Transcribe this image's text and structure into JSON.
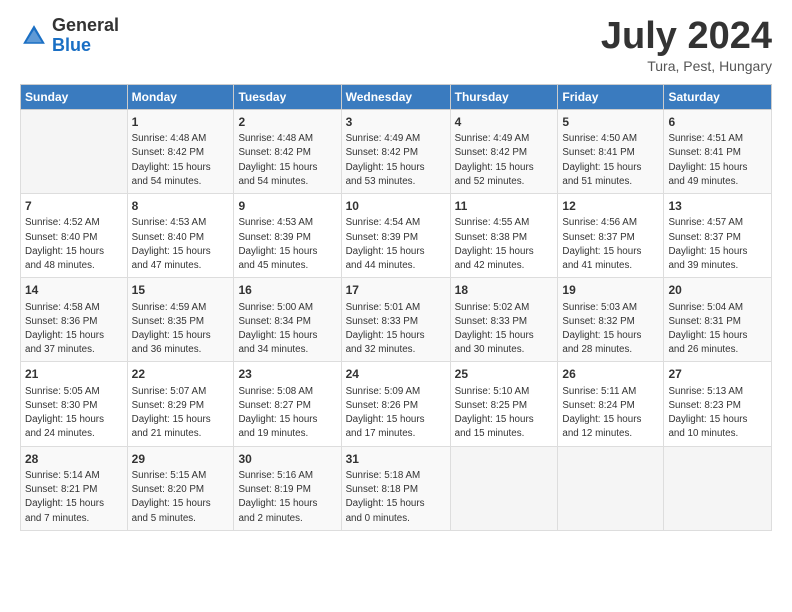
{
  "logo": {
    "general": "General",
    "blue": "Blue"
  },
  "title": "July 2024",
  "location": "Tura, Pest, Hungary",
  "header_days": [
    "Sunday",
    "Monday",
    "Tuesday",
    "Wednesday",
    "Thursday",
    "Friday",
    "Saturday"
  ],
  "weeks": [
    [
      {
        "num": "",
        "info": ""
      },
      {
        "num": "1",
        "info": "Sunrise: 4:48 AM\nSunset: 8:42 PM\nDaylight: 15 hours\nand 54 minutes."
      },
      {
        "num": "2",
        "info": "Sunrise: 4:48 AM\nSunset: 8:42 PM\nDaylight: 15 hours\nand 54 minutes."
      },
      {
        "num": "3",
        "info": "Sunrise: 4:49 AM\nSunset: 8:42 PM\nDaylight: 15 hours\nand 53 minutes."
      },
      {
        "num": "4",
        "info": "Sunrise: 4:49 AM\nSunset: 8:42 PM\nDaylight: 15 hours\nand 52 minutes."
      },
      {
        "num": "5",
        "info": "Sunrise: 4:50 AM\nSunset: 8:41 PM\nDaylight: 15 hours\nand 51 minutes."
      },
      {
        "num": "6",
        "info": "Sunrise: 4:51 AM\nSunset: 8:41 PM\nDaylight: 15 hours\nand 49 minutes."
      }
    ],
    [
      {
        "num": "7",
        "info": "Sunrise: 4:52 AM\nSunset: 8:40 PM\nDaylight: 15 hours\nand 48 minutes."
      },
      {
        "num": "8",
        "info": "Sunrise: 4:53 AM\nSunset: 8:40 PM\nDaylight: 15 hours\nand 47 minutes."
      },
      {
        "num": "9",
        "info": "Sunrise: 4:53 AM\nSunset: 8:39 PM\nDaylight: 15 hours\nand 45 minutes."
      },
      {
        "num": "10",
        "info": "Sunrise: 4:54 AM\nSunset: 8:39 PM\nDaylight: 15 hours\nand 44 minutes."
      },
      {
        "num": "11",
        "info": "Sunrise: 4:55 AM\nSunset: 8:38 PM\nDaylight: 15 hours\nand 42 minutes."
      },
      {
        "num": "12",
        "info": "Sunrise: 4:56 AM\nSunset: 8:37 PM\nDaylight: 15 hours\nand 41 minutes."
      },
      {
        "num": "13",
        "info": "Sunrise: 4:57 AM\nSunset: 8:37 PM\nDaylight: 15 hours\nand 39 minutes."
      }
    ],
    [
      {
        "num": "14",
        "info": "Sunrise: 4:58 AM\nSunset: 8:36 PM\nDaylight: 15 hours\nand 37 minutes."
      },
      {
        "num": "15",
        "info": "Sunrise: 4:59 AM\nSunset: 8:35 PM\nDaylight: 15 hours\nand 36 minutes."
      },
      {
        "num": "16",
        "info": "Sunrise: 5:00 AM\nSunset: 8:34 PM\nDaylight: 15 hours\nand 34 minutes."
      },
      {
        "num": "17",
        "info": "Sunrise: 5:01 AM\nSunset: 8:33 PM\nDaylight: 15 hours\nand 32 minutes."
      },
      {
        "num": "18",
        "info": "Sunrise: 5:02 AM\nSunset: 8:33 PM\nDaylight: 15 hours\nand 30 minutes."
      },
      {
        "num": "19",
        "info": "Sunrise: 5:03 AM\nSunset: 8:32 PM\nDaylight: 15 hours\nand 28 minutes."
      },
      {
        "num": "20",
        "info": "Sunrise: 5:04 AM\nSunset: 8:31 PM\nDaylight: 15 hours\nand 26 minutes."
      }
    ],
    [
      {
        "num": "21",
        "info": "Sunrise: 5:05 AM\nSunset: 8:30 PM\nDaylight: 15 hours\nand 24 minutes."
      },
      {
        "num": "22",
        "info": "Sunrise: 5:07 AM\nSunset: 8:29 PM\nDaylight: 15 hours\nand 21 minutes."
      },
      {
        "num": "23",
        "info": "Sunrise: 5:08 AM\nSunset: 8:27 PM\nDaylight: 15 hours\nand 19 minutes."
      },
      {
        "num": "24",
        "info": "Sunrise: 5:09 AM\nSunset: 8:26 PM\nDaylight: 15 hours\nand 17 minutes."
      },
      {
        "num": "25",
        "info": "Sunrise: 5:10 AM\nSunset: 8:25 PM\nDaylight: 15 hours\nand 15 minutes."
      },
      {
        "num": "26",
        "info": "Sunrise: 5:11 AM\nSunset: 8:24 PM\nDaylight: 15 hours\nand 12 minutes."
      },
      {
        "num": "27",
        "info": "Sunrise: 5:13 AM\nSunset: 8:23 PM\nDaylight: 15 hours\nand 10 minutes."
      }
    ],
    [
      {
        "num": "28",
        "info": "Sunrise: 5:14 AM\nSunset: 8:21 PM\nDaylight: 15 hours\nand 7 minutes."
      },
      {
        "num": "29",
        "info": "Sunrise: 5:15 AM\nSunset: 8:20 PM\nDaylight: 15 hours\nand 5 minutes."
      },
      {
        "num": "30",
        "info": "Sunrise: 5:16 AM\nSunset: 8:19 PM\nDaylight: 15 hours\nand 2 minutes."
      },
      {
        "num": "31",
        "info": "Sunrise: 5:18 AM\nSunset: 8:18 PM\nDaylight: 15 hours\nand 0 minutes."
      },
      {
        "num": "",
        "info": ""
      },
      {
        "num": "",
        "info": ""
      },
      {
        "num": "",
        "info": ""
      }
    ]
  ]
}
